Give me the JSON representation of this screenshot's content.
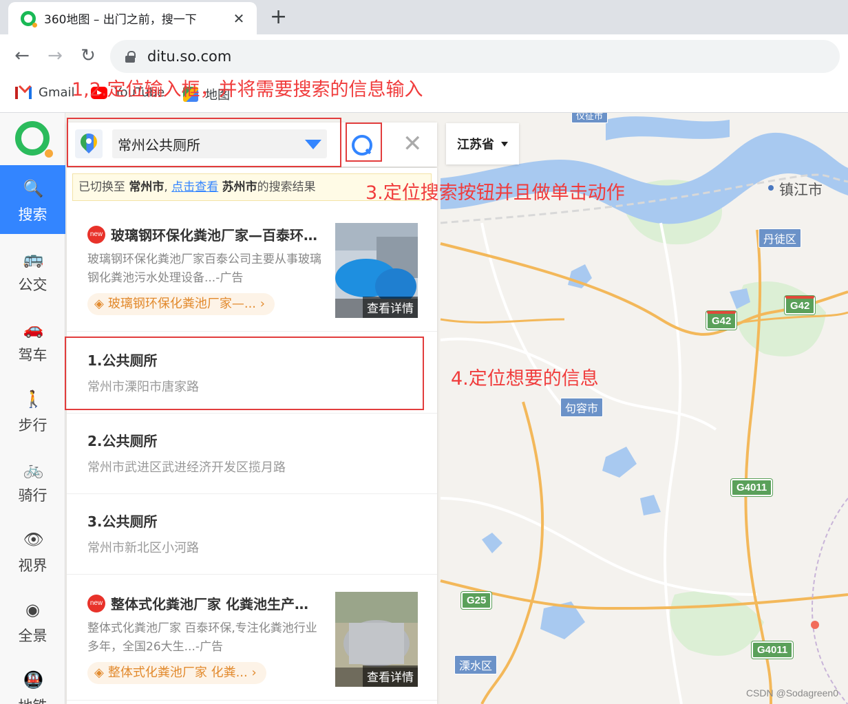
{
  "browser": {
    "tab_title": "360地图 – 出门之前，搜一下",
    "tab_close": "✕",
    "new_tab": "+",
    "back": "←",
    "forward": "→",
    "reload": "↻",
    "url": "ditu.so.com",
    "bookmarks": [
      {
        "label": "Gmail",
        "icon": "gmail-icon"
      },
      {
        "label": "YouTube",
        "icon": "youtube-icon"
      },
      {
        "label": "地图",
        "icon": "maps-icon"
      }
    ]
  },
  "annotations": {
    "step12": "1,2.定位输入框，并将需要搜索的信息输入",
    "step3": "3.定位搜索按钮并且做单击动作",
    "step4": "4.定位想要的信息"
  },
  "sidebar": {
    "items": [
      {
        "label": "搜索",
        "icon": "search-icon",
        "glyph": "🔍"
      },
      {
        "label": "公交",
        "icon": "bus-icon",
        "glyph": "🚌"
      },
      {
        "label": "驾车",
        "icon": "car-icon",
        "glyph": "🚗"
      },
      {
        "label": "步行",
        "icon": "walk-icon",
        "glyph": "🚶"
      },
      {
        "label": "骑行",
        "icon": "bike-icon",
        "glyph": "🚲"
      },
      {
        "label": "视界",
        "icon": "eye-icon",
        "glyph": "👁"
      },
      {
        "label": "全景",
        "icon": "panorama-icon",
        "glyph": "◉"
      },
      {
        "label": "地铁",
        "icon": "subway-icon",
        "glyph": "🚇"
      }
    ]
  },
  "search": {
    "query": "常州公共厕所",
    "clear": "✕",
    "province": "江苏省"
  },
  "notice": {
    "prefix": "已切换至",
    "city1": "常州市",
    "sep": ",",
    "link": "点击查看",
    "city2": "苏州市",
    "suffix": "的搜索结果"
  },
  "results": {
    "ad1": {
      "badge": "new",
      "title": "玻璃钢环保化粪池厂家—百泰环…",
      "desc": "玻璃钢环保化粪池厂家百泰公司主要从事玻璃钢化粪池污水处理设备...-广告",
      "tag": "玻璃钢环保化粪池厂家—...",
      "tag_arrow": "›",
      "detail": "查看详情"
    },
    "items": [
      {
        "title": "1.公共厕所",
        "address": "常州市溧阳市唐家路"
      },
      {
        "title": "2.公共厕所",
        "address": "常州市武进区武进经济开发区揽月路"
      },
      {
        "title": "3.公共厕所",
        "address": "常州市新北区小河路"
      }
    ],
    "ad2": {
      "badge": "new",
      "title": "整体式化粪池厂家 化粪池生产…",
      "desc": "整体式化粪池厂家 百泰环保,专注化粪池行业多年，全国26大生...-广告",
      "tag": "整体式化粪池厂家 化粪...",
      "tag_arrow": "›",
      "detail": "查看详情"
    }
  },
  "map": {
    "cities": [
      {
        "name": "镇江市"
      }
    ],
    "districts": [
      "丹徒区",
      "句容市",
      "溧水区",
      "仪征市"
    ],
    "highways": [
      "G42",
      "G42",
      "G4011",
      "G25",
      "G4011"
    ],
    "colors": {
      "water": "#a8c9f0",
      "road_major": "#f3b85a",
      "road_minor": "#ffffff",
      "green": "#cde9c4"
    }
  },
  "watermark": "CSDN @Sodagreen0"
}
